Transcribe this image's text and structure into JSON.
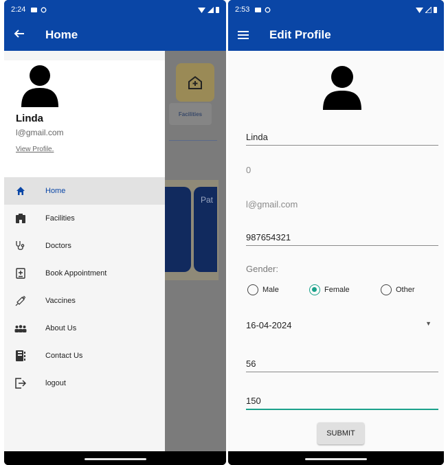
{
  "left_screen": {
    "status": {
      "time": "2:24"
    },
    "appbar": {
      "title": "Home",
      "back_icon": "arrow-left-icon"
    },
    "background": {
      "facilities_card": "Facilities",
      "banner_text": "Pat"
    },
    "drawer": {
      "user": {
        "name": "Linda",
        "email": "l@gmail.com",
        "view_profile": "View Profile."
      },
      "items": [
        {
          "label": "Home",
          "icon": "home-icon",
          "active": true
        },
        {
          "label": "Facilities",
          "icon": "hospital-icon"
        },
        {
          "label": "Doctors",
          "icon": "stethoscope-icon"
        },
        {
          "label": "Book Appointment",
          "icon": "appointment-icon"
        },
        {
          "label": "Vaccines",
          "icon": "syringe-icon"
        },
        {
          "label": "About Us",
          "icon": "group-icon"
        },
        {
          "label": "Contact Us",
          "icon": "contacts-book-icon"
        },
        {
          "label": "logout",
          "icon": "logout-icon"
        }
      ]
    }
  },
  "right_screen": {
    "status": {
      "time": "2:53"
    },
    "appbar": {
      "title": "Edit Profile",
      "menu_icon": "hamburger-icon"
    },
    "form": {
      "name": "Linda",
      "age": "0",
      "email": "l@gmail.com",
      "phone": "987654321",
      "gender_label": "Gender:",
      "gender_options": [
        "Male",
        "Female",
        "Other"
      ],
      "gender_selected": "Female",
      "date": "16-04-2024",
      "weight": "56",
      "height": "150",
      "submit_label": "SUBMIT"
    }
  },
  "colors": {
    "primary": "#0a46a6",
    "accent": "#1aa18a"
  }
}
